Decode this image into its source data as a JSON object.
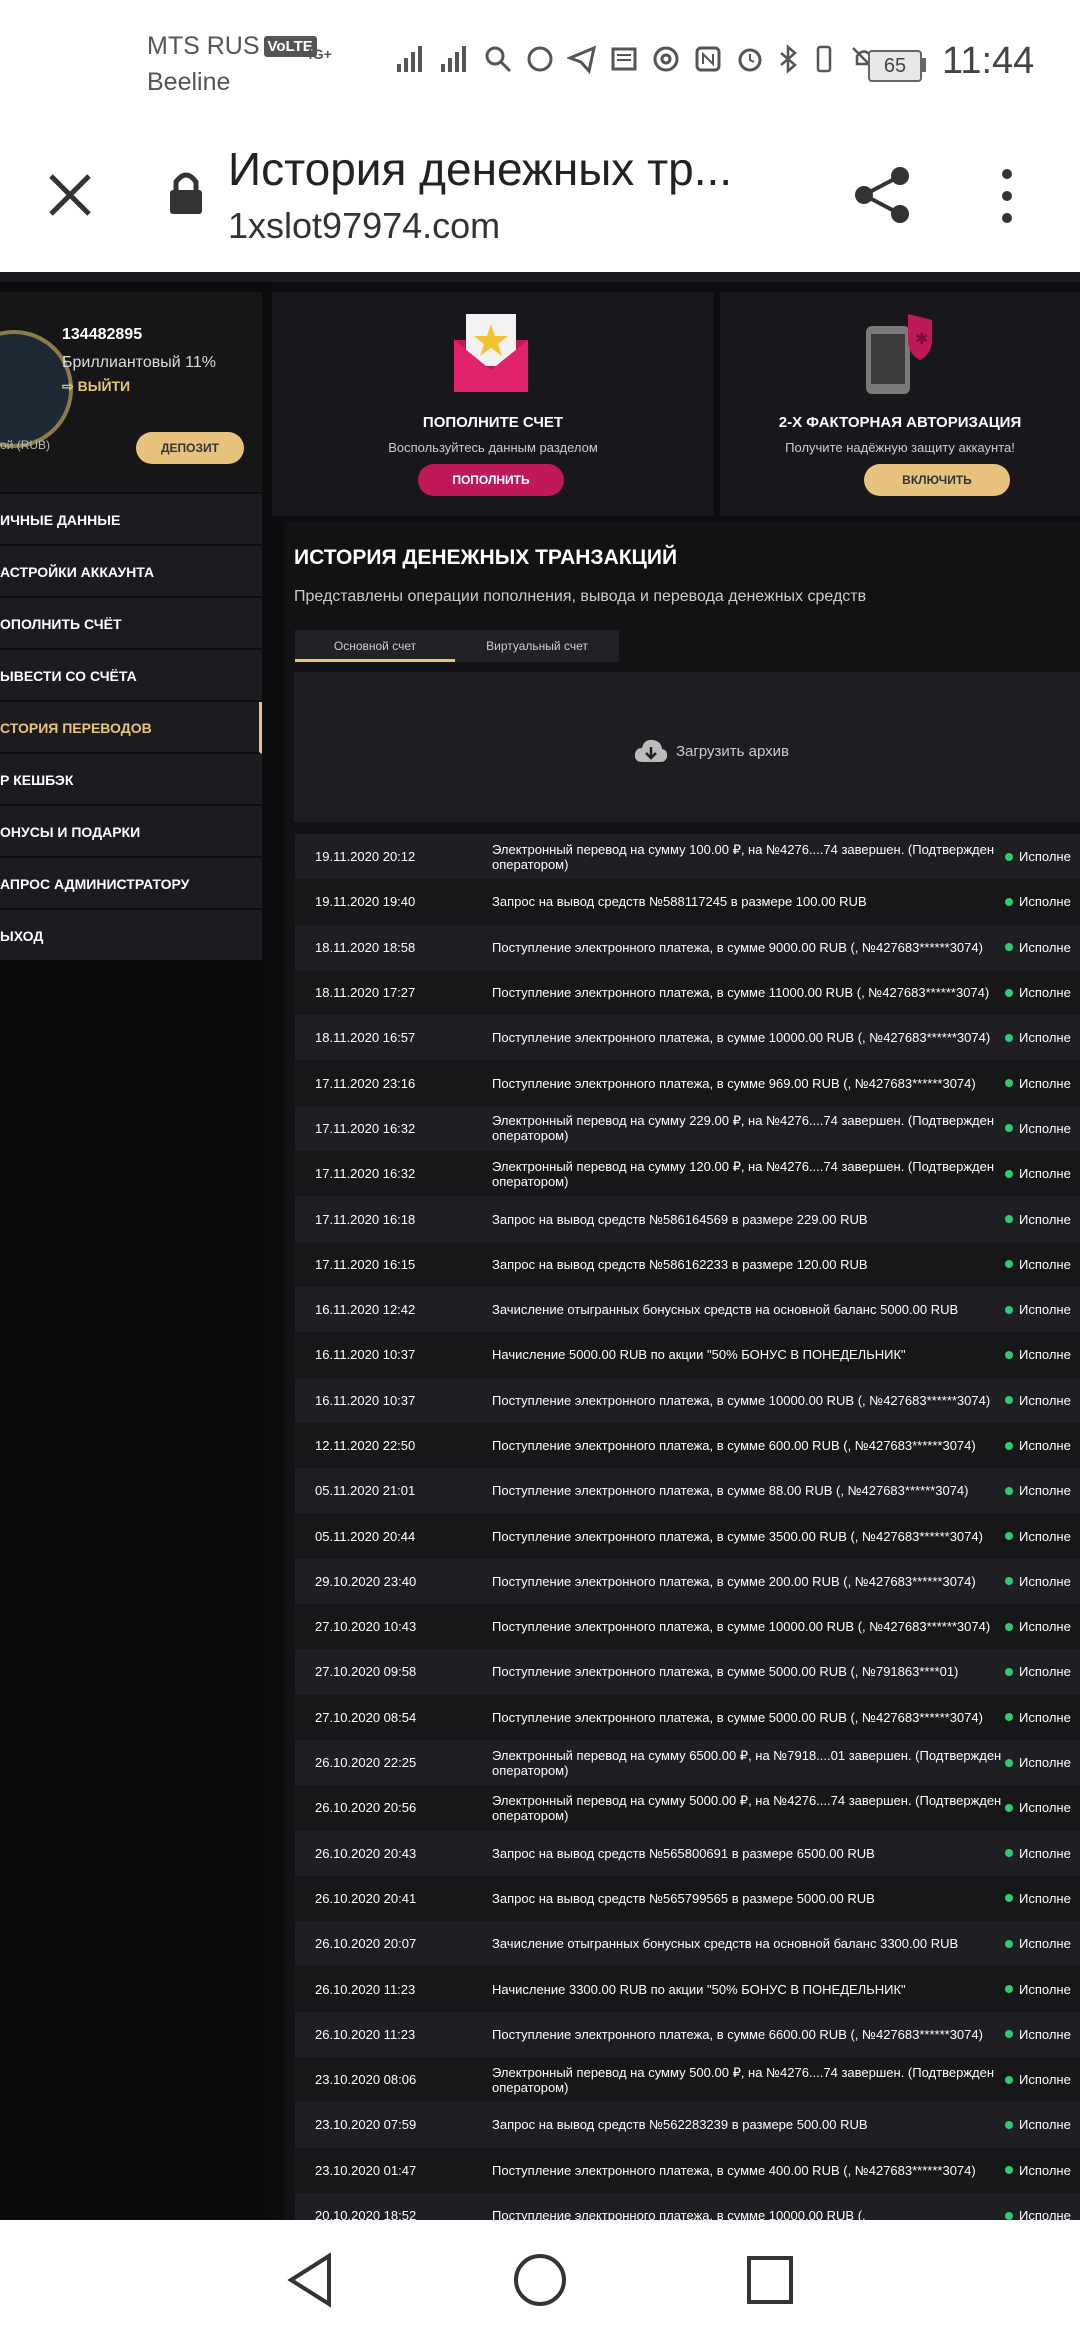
{
  "status_bar": {
    "carrier1": "MTS RUS",
    "volte": "VoLTE",
    "carrier2": "Beeline",
    "network": "4G+",
    "battery": "65",
    "time": "11:44"
  },
  "toolbar": {
    "title": "История денежных тр...",
    "url": "1xslot97974.com"
  },
  "profile": {
    "user_id": "134482895",
    "level": "Бриллиантовый 11%",
    "logout": "ВЫЙТИ",
    "currency": "ой (RUB)",
    "deposit": "ДЕПОЗИТ"
  },
  "sidebar": {
    "items": [
      {
        "label": "ичные данные"
      },
      {
        "label": "астройки аккаунта"
      },
      {
        "label": "ополнить счёт"
      },
      {
        "label": "ывести со счёта"
      },
      {
        "label": "стория переводов"
      },
      {
        "label": "р кешбэк"
      },
      {
        "label": "онусы и подарки"
      },
      {
        "label": "апрос администратору"
      },
      {
        "label": "ыход"
      }
    ]
  },
  "cards": {
    "deposit": {
      "title": "ПОПОЛНИТЕ СЧЕТ",
      "subtitle": "Воспользуйтесь данным разделом",
      "button": "ПОПОЛНИТЬ"
    },
    "twofa": {
      "title": "2-Х ФАКТОРНАЯ АВТОРИЗАЦИЯ",
      "subtitle": "Получите надёжную защиту аккаунта!",
      "button": "ВКЛЮЧИТЬ"
    }
  },
  "main": {
    "heading": "ИСТОРИЯ ДЕНЕЖНЫХ ТРАНЗАКЦИЙ",
    "description": "Представлены операции пополнения, вывода и перевода денежных средств",
    "tabs": [
      "Основной счет",
      "Виртуальный счет"
    ],
    "archive": "Загрузить архив"
  },
  "transactions": [
    {
      "date": "19.11.2020 20:12",
      "desc": "Электронный перевод на сумму 100.00 ₽, на №4276....74 завершен. (Подтвержден оператором)",
      "status": "Исполне"
    },
    {
      "date": "19.11.2020 19:40",
      "desc": "Запрос на вывод средств №588117245 в размере 100.00 RUB",
      "status": "Исполне"
    },
    {
      "date": "18.11.2020 18:58",
      "desc": "Поступление электронного платежа, в сумме 9000.00 RUB (, №427683******3074)",
      "status": "Исполне"
    },
    {
      "date": "18.11.2020 17:27",
      "desc": "Поступление электронного платежа, в сумме 11000.00 RUB (, №427683******3074)",
      "status": "Исполне"
    },
    {
      "date": "18.11.2020 16:57",
      "desc": "Поступление электронного платежа, в сумме 10000.00 RUB (, №427683******3074)",
      "status": "Исполне"
    },
    {
      "date": "17.11.2020 23:16",
      "desc": "Поступление электронного платежа, в сумме 969.00 RUB (, №427683******3074)",
      "status": "Исполне"
    },
    {
      "date": "17.11.2020 16:32",
      "desc": "Электронный перевод на сумму 229.00 ₽, на №4276....74 завершен. (Подтвержден оператором)",
      "status": "Исполне"
    },
    {
      "date": "17.11.2020 16:32",
      "desc": "Электронный перевод на сумму 120.00 ₽, на №4276....74 завершен. (Подтвержден оператором)",
      "status": "Исполне"
    },
    {
      "date": "17.11.2020 16:18",
      "desc": "Запрос на вывод средств №586164569 в размере 229.00 RUB",
      "status": "Исполне"
    },
    {
      "date": "17.11.2020 16:15",
      "desc": "Запрос на вывод средств №586162233 в размере 120.00 RUB",
      "status": "Исполне"
    },
    {
      "date": "16.11.2020 12:42",
      "desc": "Зачисление отыгранных бонусных средств на основной баланс 5000.00 RUB",
      "status": "Исполне"
    },
    {
      "date": "16.11.2020 10:37",
      "desc": "Начисление 5000.00 RUB по акции \"50% БОНУС В ПОНЕДЕЛЬНИК\"",
      "status": "Исполне"
    },
    {
      "date": "16.11.2020 10:37",
      "desc": "Поступление электронного платежа, в сумме 10000.00 RUB (, №427683******3074)",
      "status": "Исполне"
    },
    {
      "date": "12.11.2020 22:50",
      "desc": "Поступление электронного платежа, в сумме 600.00 RUB (, №427683******3074)",
      "status": "Исполне"
    },
    {
      "date": "05.11.2020 21:01",
      "desc": "Поступление электронного платежа, в сумме 88.00 RUB (, №427683******3074)",
      "status": "Исполне"
    },
    {
      "date": "05.11.2020 20:44",
      "desc": "Поступление электронного платежа, в сумме 3500.00 RUB (, №427683******3074)",
      "status": "Исполне"
    },
    {
      "date": "29.10.2020 23:40",
      "desc": "Поступление электронного платежа, в сумме 200.00 RUB (, №427683******3074)",
      "status": "Исполне"
    },
    {
      "date": "27.10.2020 10:43",
      "desc": "Поступление электронного платежа, в сумме 10000.00 RUB (, №427683******3074)",
      "status": "Исполне"
    },
    {
      "date": "27.10.2020 09:58",
      "desc": "Поступление электронного платежа, в сумме 5000.00 RUB (, №791863****01)",
      "status": "Исполне"
    },
    {
      "date": "27.10.2020 08:54",
      "desc": "Поступление электронного платежа, в сумме 5000.00 RUB (, №427683******3074)",
      "status": "Исполне"
    },
    {
      "date": "26.10.2020 22:25",
      "desc": "Электронный перевод на сумму 6500.00 ₽, на №7918....01 завершен. (Подтвержден оператором)",
      "status": "Исполне"
    },
    {
      "date": "26.10.2020 20:56",
      "desc": "Электронный перевод на сумму 5000.00 ₽, на №4276....74 завершен. (Подтвержден оператором)",
      "status": "Исполне"
    },
    {
      "date": "26.10.2020 20:43",
      "desc": "Запрос на вывод средств №565800691 в размере 6500.00 RUB",
      "status": "Исполне"
    },
    {
      "date": "26.10.2020 20:41",
      "desc": "Запрос на вывод средств №565799565 в размере 5000.00 RUB",
      "status": "Исполне"
    },
    {
      "date": "26.10.2020 20:07",
      "desc": "Зачисление отыгранных бонусных средств на основной баланс 3300.00 RUB",
      "status": "Исполне"
    },
    {
      "date": "26.10.2020 11:23",
      "desc": "Начисление 3300.00 RUB по акции \"50% БОНУС В ПОНЕДЕЛЬНИК\"",
      "status": "Исполне"
    },
    {
      "date": "26.10.2020 11:23",
      "desc": "Поступление электронного платежа, в сумме 6600.00 RUB (, №427683******3074)",
      "status": "Исполне"
    },
    {
      "date": "23.10.2020 08:06",
      "desc": "Электронный перевод на сумму 500.00 ₽, на №4276....74 завершен. (Подтвержден оператором)",
      "status": "Исполне"
    },
    {
      "date": "23.10.2020 07:59",
      "desc": "Запрос на вывод средств №562283239 в размере 500.00 RUB",
      "status": "Исполне"
    },
    {
      "date": "23.10.2020 01:47",
      "desc": "Поступление электронного платежа, в сумме 400.00 RUB (, №427683******3074)",
      "status": "Исполне"
    },
    {
      "date": "20.10.2020 18:52",
      "desc": "Поступление электронного платежа, в сумме 10000.00 RUB (,",
      "status": "Исполне"
    }
  ],
  "colors": {
    "accent_gold": "#e6c47a",
    "accent_pink": "#c0195a",
    "status_green": "#2ecc71"
  }
}
